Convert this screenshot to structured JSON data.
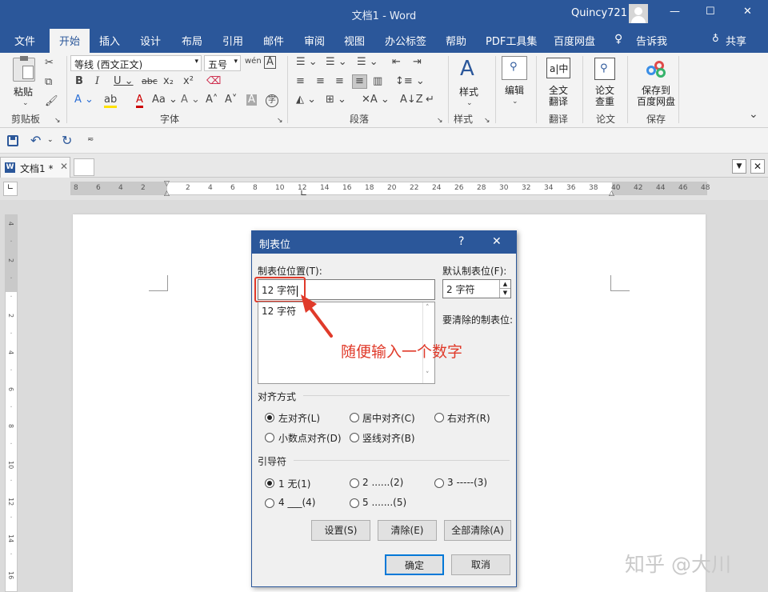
{
  "window": {
    "title": "文档1 - Word",
    "user": "Quincy721",
    "minimize": "—",
    "maximize": "☐",
    "close": "✕"
  },
  "tabs": [
    {
      "label": "文件"
    },
    {
      "label": "开始"
    },
    {
      "label": "插入"
    },
    {
      "label": "设计"
    },
    {
      "label": "布局"
    },
    {
      "label": "引用"
    },
    {
      "label": "邮件"
    },
    {
      "label": "审阅"
    },
    {
      "label": "视图"
    },
    {
      "label": "办公标签"
    },
    {
      "label": "帮助"
    },
    {
      "label": "PDF工具集"
    },
    {
      "label": "百度网盘"
    }
  ],
  "tell_me": "告诉我",
  "share": "共享",
  "ribbon": {
    "paste": "粘贴",
    "font_name": "等线 (西文正文)",
    "font_size": "五号",
    "group_clipboard": "剪贴板",
    "group_font": "字体",
    "group_paragraph": "段落",
    "styles": "样式",
    "group_styles": "样式",
    "edit": "编辑",
    "translate": "全文\n翻译",
    "group_translate": "翻译",
    "paper_check": "论文\n查重",
    "group_paper": "论文",
    "save_baidu": "保存到\n百度网盘",
    "group_save": "保存"
  },
  "doc_tab": "文档1 *",
  "ruler_numbers": [
    "8",
    "6",
    "4",
    "2",
    "",
    "2",
    "4",
    "6",
    "8",
    "10",
    "12",
    "14",
    "16",
    "18",
    "20",
    "22",
    "24",
    "26",
    "28",
    "30",
    "32",
    "34",
    "36",
    "38",
    "40",
    "42",
    "44",
    "46",
    "48"
  ],
  "dialog": {
    "title": "制表位",
    "help": "?",
    "close": "✕",
    "tab_pos_label": "制表位位置(T):",
    "tab_pos_value": "12 字符",
    "default_label": "默认制表位(F):",
    "default_value": "2 字符",
    "list_items": [
      "12 字符"
    ],
    "to_clear_label": "要清除的制表位:",
    "align_label": "对齐方式",
    "align_options": [
      "左对齐(L)",
      "居中对齐(C)",
      "右对齐(R)",
      "小数点对齐(D)",
      "竖线对齐(B)"
    ],
    "leader_label": "引导符",
    "leader_options": [
      "1 无(1)",
      "2 ......(2)",
      "3 -----(3)",
      "4 ___(4)",
      "5 .......(5)"
    ],
    "set_button": "设置(S)",
    "clear_button": "清除(E)",
    "clear_all_button": "全部清除(A)",
    "ok_button": "确定",
    "cancel_button": "取消"
  },
  "annotation": "随便输入一个数字",
  "watermark": "知乎 @大川",
  "colors": {
    "brand": "#2b579a",
    "annotation_red": "#e03a2a"
  }
}
